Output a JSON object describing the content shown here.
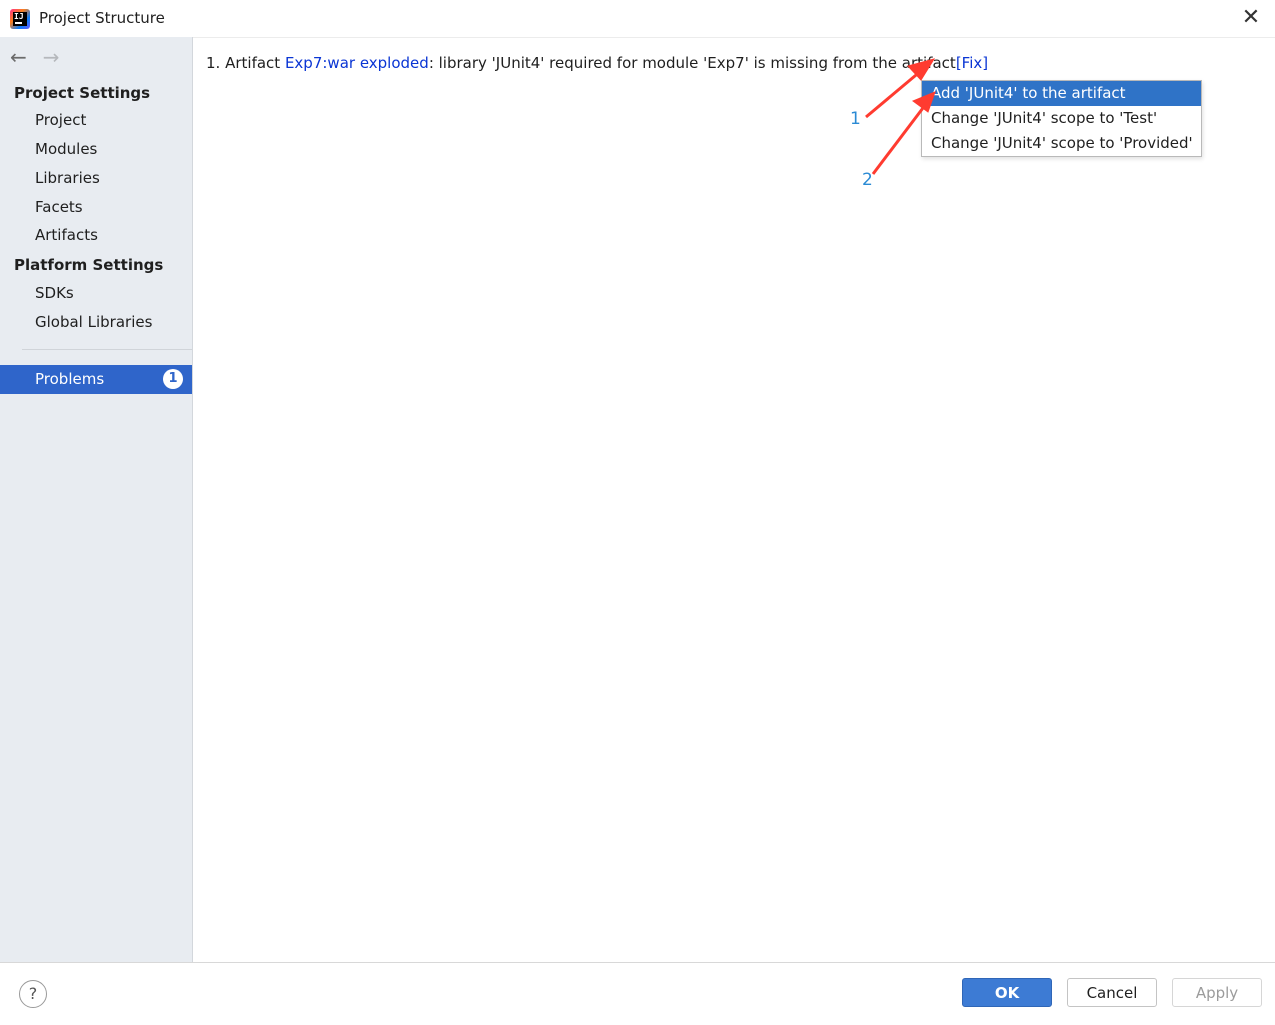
{
  "window": {
    "title": "Project Structure",
    "close_glyph": "✕",
    "app_icon": "intellij-idea-icon",
    "app_icon_text": "IJ"
  },
  "nav": {
    "back_glyph": "←",
    "forward_glyph": "→"
  },
  "sidebar": {
    "project_settings_header": "Project Settings",
    "project_settings_items": [
      "Project",
      "Modules",
      "Libraries",
      "Facets",
      "Artifacts"
    ],
    "platform_settings_header": "Platform Settings",
    "platform_settings_items": [
      "SDKs",
      "Global Libraries"
    ],
    "problems": {
      "label": "Problems",
      "count": "1"
    }
  },
  "main": {
    "problem": {
      "index": "1.",
      "prefix": "Artifact",
      "artifact_link": "Exp7:war exploded",
      "message": ": library 'JUnit4' required for module 'Exp7' is missing from the artifact",
      "fix_link": "[Fix]"
    },
    "popup_items": [
      "Add 'JUnit4' to the artifact",
      "Change 'JUnit4' scope to 'Test'",
      "Change 'JUnit4' scope to 'Provided'"
    ],
    "annotations": [
      "1",
      "2"
    ],
    "annotation_color": "#ff3b30"
  },
  "footer": {
    "help_glyph": "?",
    "ok_label": "OK",
    "cancel_label": "Cancel",
    "apply_label": "Apply"
  },
  "colors": {
    "selection": "#2f65ca",
    "link": "#0a35d4",
    "sidebar_bg": "#e8ecf1",
    "ok_button": "#3d7bd4"
  }
}
